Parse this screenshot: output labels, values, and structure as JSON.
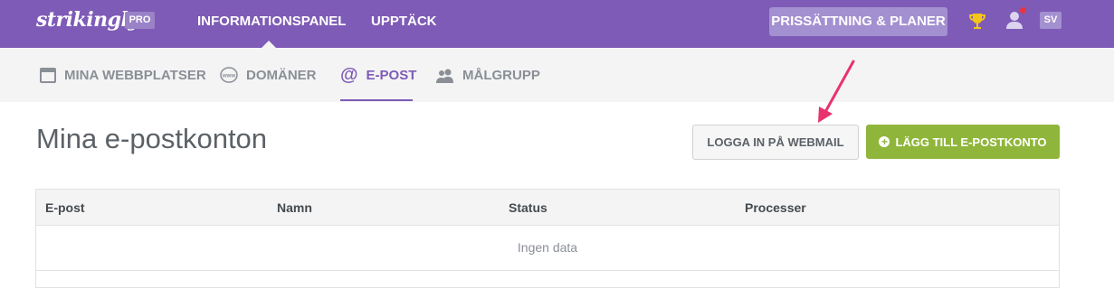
{
  "topbar": {
    "logo": "strikingly",
    "pro_badge": "PRO",
    "nav": [
      "INFORMATIONSPANEL",
      "UPPTÄCK"
    ],
    "pricing_button": "PRISSÄTTNING & PLANER",
    "lang": "SV",
    "icons": [
      "trophy-icon",
      "user-icon"
    ],
    "colors": {
      "background": "#7e5bb6",
      "notification": "#e8353f"
    }
  },
  "subnav": {
    "items": [
      {
        "label": "MINA WEBBPLATSER",
        "icon": "browser-window-icon"
      },
      {
        "label": "DOMÄNER",
        "icon": "www-globe-icon"
      },
      {
        "label": "E-POST",
        "icon": "at-sign-icon",
        "active": true
      },
      {
        "label": "MÅLGRUPP",
        "icon": "people-icon"
      }
    ]
  },
  "main": {
    "title": "Mina e-postkonton",
    "webmail_button": "LOGGA IN PÅ WEBMAIL",
    "add_button": "LÄGG TILL E-POSTKONTO",
    "table": {
      "columns": [
        "E-post",
        "Namn",
        "Status",
        "Processer"
      ],
      "empty_text": "Ingen data"
    },
    "colors": {
      "accent": "#8fb63b",
      "annotation_arrow": "#e8336e"
    }
  }
}
